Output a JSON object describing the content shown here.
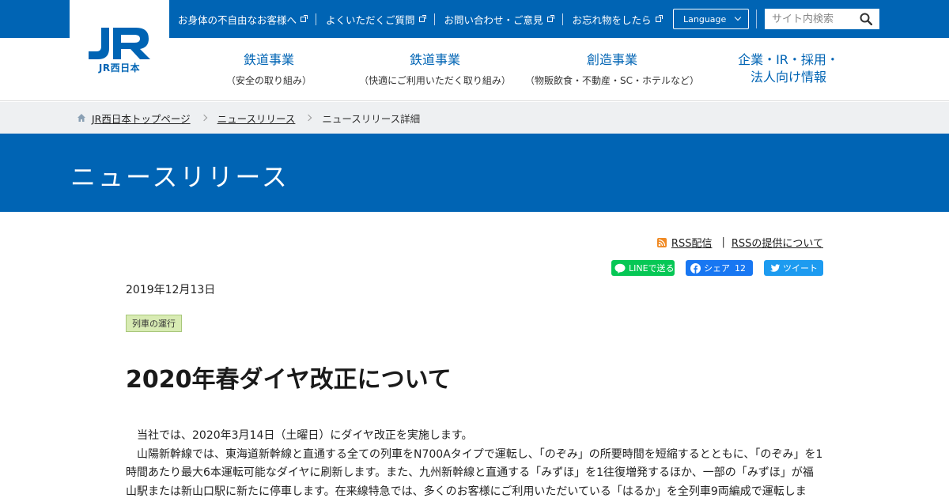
{
  "utility_links": [
    {
      "label": "お身体の不自由なお客様へ"
    },
    {
      "label": "よくいただくご質問"
    },
    {
      "label": "お問い合わせ・ご意見"
    },
    {
      "label": "お忘れ物をしたら"
    }
  ],
  "language": {
    "label": "Language"
  },
  "search": {
    "placeholder": "サイト内検索"
  },
  "logo": {
    "sub": "JR西日本"
  },
  "nav": [
    {
      "title": "鉄道事業",
      "sub": "（安全の取り組み）"
    },
    {
      "title": "鉄道事業",
      "sub": "（快適にご利用いただく取り組み）"
    },
    {
      "title": "創造事業",
      "sub": "（物販飲食・不動産・SC・ホテルなど）"
    },
    {
      "title_line1": "企業・IR・採用・",
      "title_line2": "法人向け情報"
    }
  ],
  "breadcrumb": {
    "home": "JR西日本トップページ",
    "parent": "ニュースリリース",
    "current": "ニュースリリース詳細"
  },
  "banner": {
    "title": "ニュースリリース"
  },
  "rss": {
    "feed": "RSS配信",
    "about": "RSSの提供について"
  },
  "share": {
    "line": "LINEで送る",
    "facebook": "シェア",
    "facebook_count": "12",
    "twitter": "ツイート"
  },
  "article": {
    "date": "2019年12月13日",
    "tag": "列車の運行",
    "title": "2020年春ダイヤ改正について",
    "para1": "当社では、2020年3月14日（土曜日）にダイヤ改正を実施します。",
    "para2": "山陽新幹線では、東海道新幹線と直通する全ての列車をN700Aタイプで運転し、「のぞみ」の所要時間を短縮するとともに、「のぞみ」を1時間あたり最大6本運転可能なダイヤに刷新します。また、九州新幹線と直通する「みずほ」を1往復増発するほか、一部の「みずほ」が福山駅または新山口駅に新たに停車します。在来線特急では、多くのお客様にご利用いただいている「はるか」を全列車9両編成で運転しま"
  },
  "colors": {
    "brand": "#0064b4",
    "breadcrumb_bg": "#eef0f2",
    "tag_bg": "#d8ebb3"
  }
}
